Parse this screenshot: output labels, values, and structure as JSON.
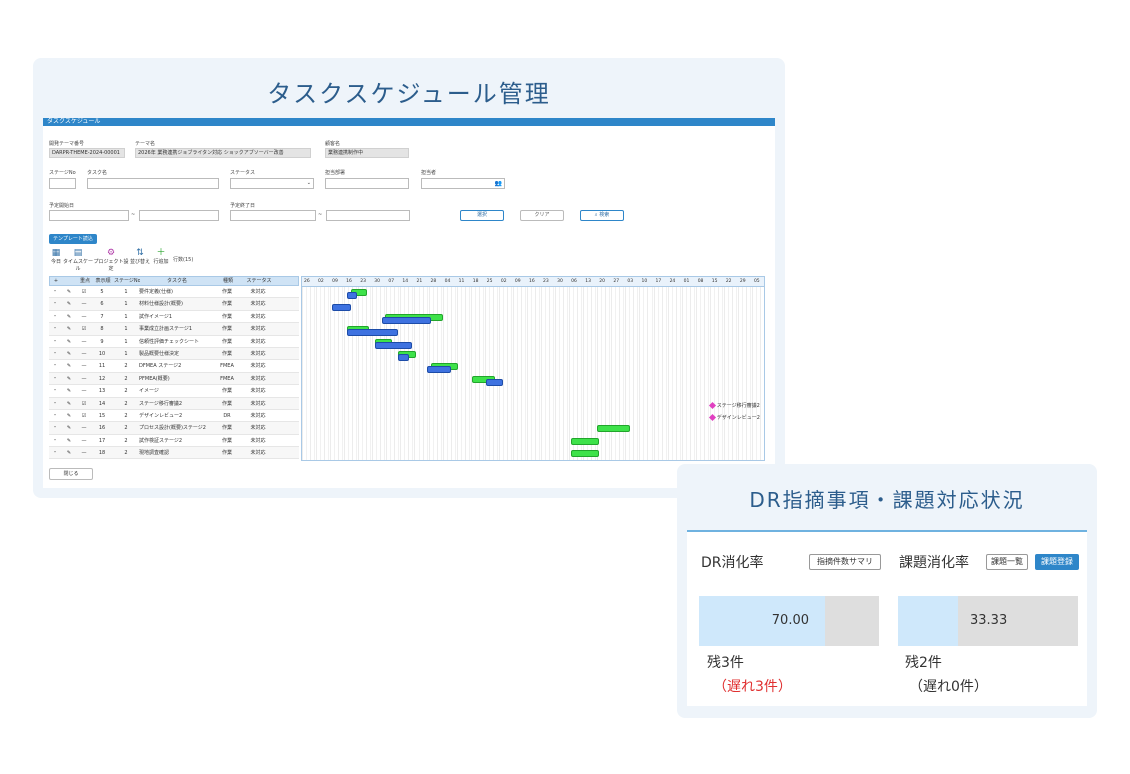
{
  "task_card": {
    "title": "タスクスケジュール管理",
    "header": "タスクスケジュール",
    "fields": {
      "theme_no_label": "開発テーマ番号",
      "theme_no_value": "DARPR-THEME-2024-00001",
      "theme_name_label": "テーマ名",
      "theme_name_value": "2026年 業務連携ジョブライタン対応 ショックアブソーバー改善",
      "client_label": "顧客名",
      "client_value": "業務連携制作中",
      "stage_no_label": "ステージNo",
      "task_name_label": "タスク名",
      "status_label": "ステータス",
      "dept_label": "担当部署",
      "person_label": "担当者",
      "plan_start_label": "予定開始日",
      "plan_end_label": "予定終了日",
      "select_button": "選択",
      "clear_button": "クリア",
      "search_button": "検索"
    },
    "template_button": "テンプレート読込",
    "toolbar": [
      {
        "label": "今日",
        "icon": "calendar-icon"
      },
      {
        "label": "タイムスケール",
        "icon": "timescale-icon"
      },
      {
        "label": "プロジェクト設定",
        "icon": "project-settings-icon"
      },
      {
        "label": "並び替え",
        "icon": "sort-icon"
      },
      {
        "label": "行追加",
        "icon": "add-row-icon"
      }
    ],
    "row_count": "行数(15)",
    "columns": [
      "+",
      "",
      "重点",
      "表示順",
      "ステージNo",
      "タスク名",
      "種類",
      "ステータス"
    ],
    "rows": [
      {
        "checked": true,
        "order": "5",
        "stage": "1",
        "task": "要件定義(仕様)",
        "type": "作業",
        "status": "未対応"
      },
      {
        "checked": false,
        "order": "6",
        "stage": "1",
        "task": "材料仕様設計(概要)",
        "type": "作業",
        "status": "未対応"
      },
      {
        "checked": false,
        "order": "7",
        "stage": "1",
        "task": "試作イメージ1",
        "type": "作業",
        "status": "未対応"
      },
      {
        "checked": true,
        "order": "8",
        "stage": "1",
        "task": "事業成立計画ステージ1",
        "type": "作業",
        "status": "未対応"
      },
      {
        "checked": false,
        "order": "9",
        "stage": "1",
        "task": "信頼性評価チェックシート",
        "type": "作業",
        "status": "未対応"
      },
      {
        "checked": false,
        "order": "10",
        "stage": "1",
        "task": "製品概要仕様決定",
        "type": "作業",
        "status": "未対応"
      },
      {
        "checked": false,
        "order": "11",
        "stage": "2",
        "task": "DFMEA ステージ2",
        "type": "FMEA",
        "status": "未対応"
      },
      {
        "checked": false,
        "order": "12",
        "stage": "2",
        "task": "PFMEA(概要)",
        "type": "FMEA",
        "status": "未対応"
      },
      {
        "checked": false,
        "order": "13",
        "stage": "2",
        "task": "イメージ",
        "type": "作業",
        "status": "未対応"
      },
      {
        "checked": true,
        "order": "14",
        "stage": "2",
        "task": "ステージ移行審議2",
        "type": "作業",
        "status": "未対応"
      },
      {
        "checked": true,
        "order": "15",
        "stage": "2",
        "task": "デザインレビュー2",
        "type": "DR",
        "status": "未対応"
      },
      {
        "checked": false,
        "order": "16",
        "stage": "2",
        "task": "プロセス設計(概要)ステージ2",
        "type": "作業",
        "status": "未対応"
      },
      {
        "checked": false,
        "order": "17",
        "stage": "2",
        "task": "試作検証ステージ2",
        "type": "作業",
        "status": "未対応"
      },
      {
        "checked": false,
        "order": "18",
        "stage": "2",
        "task": "現地調査確認",
        "type": "作業",
        "status": "未対応"
      }
    ],
    "gantt_days": [
      "26",
      "02",
      "09",
      "16",
      "23",
      "30",
      "07",
      "14",
      "21",
      "28",
      "04",
      "11",
      "18",
      "25",
      "02",
      "09",
      "16",
      "23",
      "30",
      "06",
      "13",
      "20",
      "27",
      "03",
      "10",
      "17",
      "24",
      "01",
      "08",
      "15",
      "22",
      "29",
      "05"
    ],
    "gantt_bars": [
      {
        "row": 0,
        "kind": "plan",
        "start": 3.5,
        "end": 4.6
      },
      {
        "row": 0,
        "kind": "act",
        "start": 3.2,
        "end": 3.9
      },
      {
        "row": 1,
        "kind": "act",
        "start": 2.1,
        "end": 3.5
      },
      {
        "row": 2,
        "kind": "plan",
        "start": 5.9,
        "end": 10.0
      },
      {
        "row": 2,
        "kind": "act",
        "start": 5.7,
        "end": 9.2
      },
      {
        "row": 3,
        "kind": "plan",
        "start": 3.2,
        "end": 4.8
      },
      {
        "row": 3,
        "kind": "act",
        "start": 3.2,
        "end": 6.8
      },
      {
        "row": 4,
        "kind": "plan",
        "start": 5.2,
        "end": 6.4
      },
      {
        "row": 4,
        "kind": "act",
        "start": 5.2,
        "end": 7.8
      },
      {
        "row": 5,
        "kind": "plan",
        "start": 6.8,
        "end": 8.1
      },
      {
        "row": 5,
        "kind": "act",
        "start": 6.8,
        "end": 7.6
      },
      {
        "row": 6,
        "kind": "plan",
        "start": 9.2,
        "end": 11.1
      },
      {
        "row": 6,
        "kind": "act",
        "start": 8.9,
        "end": 10.6
      },
      {
        "row": 7,
        "kind": "plan",
        "start": 12.1,
        "end": 13.7
      },
      {
        "row": 7,
        "kind": "act",
        "start": 13.1,
        "end": 14.3
      },
      {
        "row": 11,
        "kind": "plan",
        "start": 21.0,
        "end": 23.3
      },
      {
        "row": 12,
        "kind": "plan",
        "start": 19.1,
        "end": 21.1
      },
      {
        "row": 13,
        "kind": "plan",
        "start": 19.1,
        "end": 21.1
      }
    ],
    "milestones": [
      {
        "row": 9,
        "label": "ステージ移行審議2",
        "at": 29.0
      },
      {
        "row": 10,
        "label": "デザインレビュー2",
        "at": 29.0
      }
    ],
    "close_button": "閉じる"
  },
  "dr_card": {
    "title": "DR指摘事項・課題対応状況",
    "dr": {
      "label": "DR消化率",
      "button": "指摘件数サマリ",
      "value": "70.00",
      "percent": 70,
      "remain": "残3件",
      "late": "（遅れ3件）"
    },
    "issue": {
      "label": "課題消化率",
      "list_button": "課題一覧",
      "register_button": "課題登録",
      "value": "33.33",
      "percent": 33.33,
      "remain": "残2件",
      "late": "（遅れ0件）"
    },
    "colors": {
      "late_red": "#e03030",
      "accent": "#2e86c9"
    }
  }
}
